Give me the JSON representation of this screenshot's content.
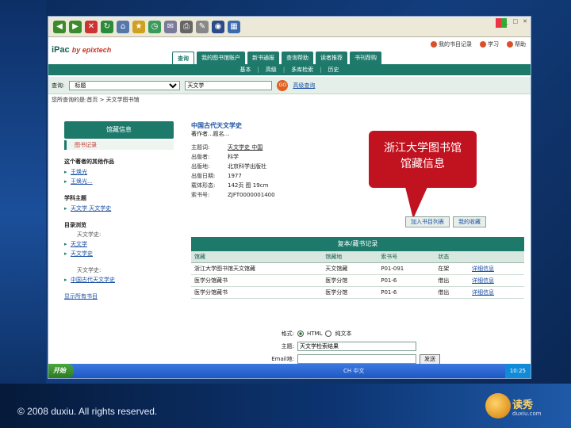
{
  "slide": {
    "copyright": "© 2008 duxiu. All rights reserved.",
    "logo_text": "读秀",
    "logo_sub": "duxiu.com"
  },
  "browser": {
    "ipac_brand": "iPac",
    "ipac_by": "by epixtech",
    "top_links": [
      "我的书目记录",
      "学习",
      "帮助"
    ],
    "tabs": [
      {
        "label": "查询",
        "active": true
      },
      {
        "label": "我的图书馆账户",
        "active": false
      },
      {
        "label": "新书通报",
        "active": false
      },
      {
        "label": "查询帮助",
        "active": false
      },
      {
        "label": "读者推荐",
        "active": false
      },
      {
        "label": "书刊荐购",
        "active": false
      }
    ],
    "subnav": [
      "基本",
      "高级",
      "多库检索",
      "历史"
    ],
    "search": {
      "label": "查询:",
      "select_value": "标题",
      "input_value": "天文学",
      "go_label": "GO",
      "extra_link": "高级查询"
    },
    "breadcrumb": "您所查询的是:首页 > 天文学图书馆"
  },
  "left_panel": {
    "title": "馆藏信息",
    "active_item": "图书记录",
    "sections": [
      {
        "heading": "这个著者的其他作品",
        "items": [
          "王焕光",
          "王焕光..."
        ],
        "subs": []
      },
      {
        "heading": "学科主题",
        "items": [
          "天文学 天文学史"
        ],
        "subs": []
      },
      {
        "heading": "目录浏览",
        "items": [
          "天文学",
          "天文学史"
        ],
        "subs": [
          "天文学史:"
        ]
      },
      {
        "heading": "",
        "items": [
          "中国古代天文学史"
        ],
        "subs": [
          "天文学史:"
        ]
      }
    ],
    "footer_link": "显示所有书目"
  },
  "record": {
    "title": "中国古代天文学史",
    "subtitle": "著作者...题名...",
    "rows": [
      {
        "k": "主题词:",
        "v": "天文学史 中国"
      },
      {
        "k": "出版者:",
        "v": "科学"
      },
      {
        "k": "出版地:",
        "v": "北京科学出版社"
      },
      {
        "k": "出版日期:",
        "v": "1977"
      },
      {
        "k": "载体形态:",
        "v": "142页 图 19cm"
      },
      {
        "k": "索书号:",
        "v": "ZJFT0000001400"
      }
    ]
  },
  "callout": {
    "line1": "浙江大学图书馆",
    "line2": "馆藏信息"
  },
  "buttons": [
    "加入书目列表",
    "我的收藏"
  ],
  "holdings": {
    "title": "复本/藏书记录",
    "columns": [
      "馆藏",
      "馆藏地",
      "索书号",
      "状态",
      ""
    ],
    "rows": [
      [
        "浙江大学图书馆天文馆藏",
        "天文馆藏",
        "P01-091",
        "在架",
        "详细信息"
      ],
      [
        "医学分馆藏书",
        "医学分馆",
        "P01-6",
        "借出",
        "详细信息"
      ],
      [
        "医学分馆藏书",
        "医学分馆",
        "P01-6",
        "借出",
        "详细信息"
      ]
    ]
  },
  "export": {
    "format_label": "格式:",
    "format_html": "HTML",
    "format_text": "纯文本",
    "subject_label": "主题:",
    "subject_value": "天文学检索结果",
    "email_label": "Email地:",
    "send_label": "发送"
  },
  "taskbar": {
    "start": "开始",
    "lang": "CH 中文",
    "time": "10:25"
  }
}
